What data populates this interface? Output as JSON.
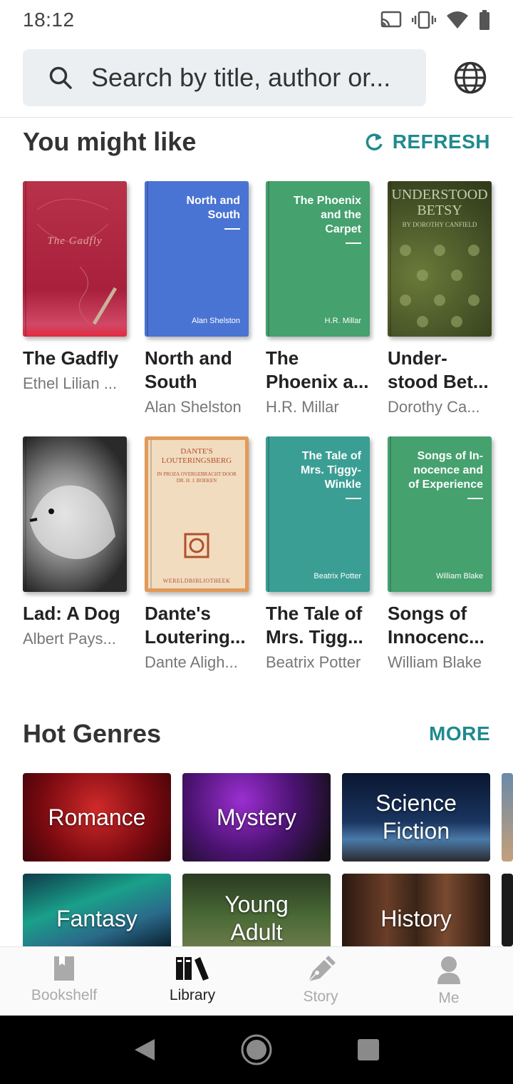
{
  "status_bar": {
    "time": "18:12"
  },
  "search": {
    "placeholder": "Search by title, author or..."
  },
  "you_might_like": {
    "title": "You might like",
    "action": "REFRESH",
    "books": [
      {
        "title": "The Gadfly",
        "author": "Ethel Lilian ...",
        "cover_title": "The Gadfly",
        "cover_author": ""
      },
      {
        "title": "North and South",
        "author": "Alan Shelston",
        "cover_title": "North and South",
        "cover_author": "Alan Shelston"
      },
      {
        "title": "The Phoenix a...",
        "author": "H.R. Millar",
        "cover_title": "The Phoenix and the Carpet",
        "cover_author": "H.R. Millar"
      },
      {
        "title": "Under-stood Bet...",
        "author": "Dorothy Ca...",
        "cover_title": "UNDERSTOOD BETSY",
        "cover_subtitle": "BY DOROTHY CANFIELD"
      },
      {
        "title": "Lad: A Dog",
        "author": "Albert Pays...",
        "cover_title": "",
        "cover_author": ""
      },
      {
        "title": "Dante's Loutering...",
        "author": "Dante Aligh...",
        "cover_title": "DANTE'S LOUTERINGSBERG",
        "cover_subtitle": "IN PROZA OVERGEBRACHT DOOR DR. H. J. BOEKEN",
        "cover_footer": "WERELDBIBLIOTHEEK"
      },
      {
        "title": "The Tale of Mrs. Tigg...",
        "author": "Beatrix Potter",
        "cover_title": "The Tale of Mrs. Tiggy-Winkle",
        "cover_author": "Beatrix Potter"
      },
      {
        "title": "Songs of Innocenc...",
        "author": "William Blake",
        "cover_title": "Songs of In-nocence and of Experience",
        "cover_author": "William Blake"
      }
    ]
  },
  "hot_genres": {
    "title": "Hot Genres",
    "action": "MORE",
    "items": [
      {
        "label": "Romance"
      },
      {
        "label": "Mystery"
      },
      {
        "label": "Science Fiction"
      },
      {
        "label": "Fantasy"
      },
      {
        "label": "Young Adult"
      },
      {
        "label": "History"
      }
    ]
  },
  "bottom_nav": {
    "items": [
      {
        "label": "Bookshelf",
        "icon": "bookmark-icon",
        "active": false
      },
      {
        "label": "Library",
        "icon": "library-icon",
        "active": true
      },
      {
        "label": "Story",
        "icon": "pen-icon",
        "active": false
      },
      {
        "label": "Me",
        "icon": "person-icon",
        "active": false
      }
    ]
  },
  "colors": {
    "accent": "#1f8a8f",
    "blue_cover": "#4a74d3",
    "green_cover": "#45a16e",
    "teal_cover": "#3a9e94"
  }
}
